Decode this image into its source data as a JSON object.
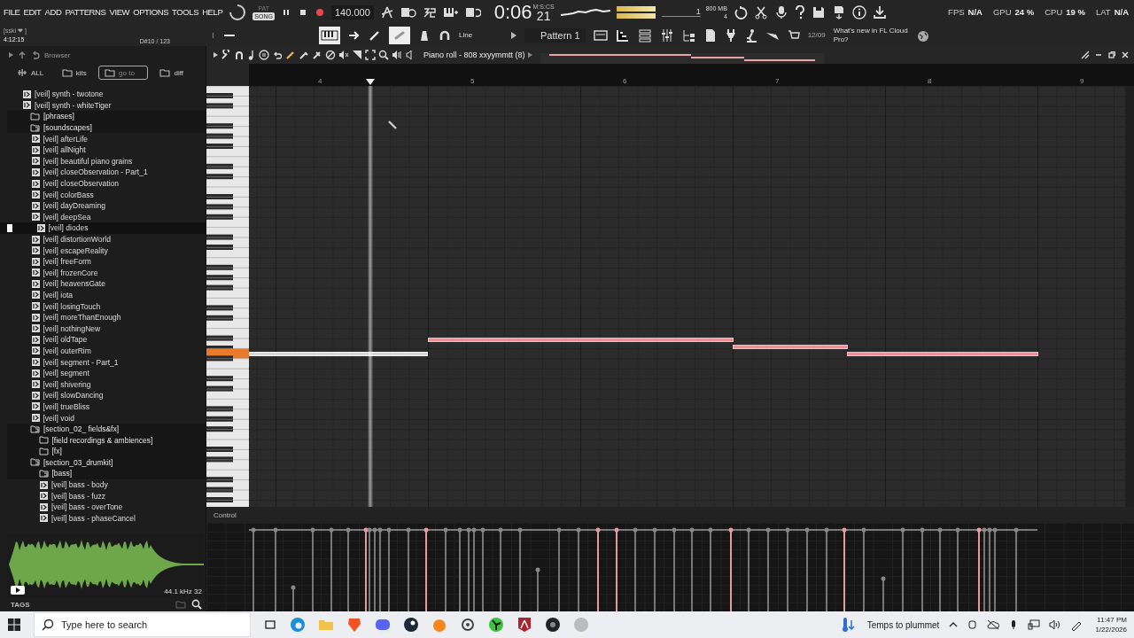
{
  "menu": [
    "FILE",
    "EDIT",
    "ADD",
    "PATTERNS",
    "VIEW",
    "OPTIONS",
    "TOOLS",
    "HELP"
  ],
  "transport": {
    "modes": [
      {
        "label": "PAT",
        "selected": false
      },
      {
        "label": "SONG",
        "selected": true
      }
    ],
    "tempo": "140.000",
    "time": "0:06",
    "time_cs": "21",
    "time_unit": "M:S:CS"
  },
  "meters": {
    "voices": "1",
    "memory": "800 MB",
    "cores": "4"
  },
  "stats": [
    {
      "label": "FPS",
      "value": "N/A"
    },
    {
      "label": "GPU",
      "value": "24 %"
    },
    {
      "label": "CPU",
      "value": "19 %"
    },
    {
      "label": "LAT",
      "value": "N/A"
    }
  ],
  "hint": {
    "user": "[sski ❤ ]",
    "position": "4:12:15",
    "note": "D#10 / 123"
  },
  "toolbar": {
    "zoom": {
      "level": 0.12
    },
    "snap": "Line",
    "pattern": "Pattern 1",
    "news_date": "12/09",
    "news_text": "What's new in FL Cloud Pro?"
  },
  "browser": {
    "title": "Browser",
    "filters": [
      {
        "label": "ALL",
        "selected": false
      },
      {
        "label": "kits",
        "selected": false
      },
      {
        "label": "go to",
        "selected": true
      },
      {
        "label": "diff",
        "selected": false
      }
    ],
    "tree": [
      {
        "children": [
          {
            "children": [
              {
                "label": "[veil] synth - twotone",
                "kind": "file",
                "selected": false
              },
              {
                "label": "[veil] synth - whiteTiger",
                "kind": "file",
                "selected": false
              }
            ]
          },
          {
            "label": "[phrases]",
            "kind": "folder",
            "expanded": false,
            "selected": false
          },
          {
            "label": "[soundscapes]",
            "kind": "folder",
            "expanded": true,
            "selected": false,
            "children": [
              {
                "label": "[veil] afterLife",
                "kind": "file",
                "selected": false
              },
              {
                "label": "[veil] allNight",
                "kind": "file",
                "selected": false
              },
              {
                "label": "[veil] beautiful piano grains",
                "kind": "file",
                "selected": false
              },
              {
                "label": "[veil] closeObservation - Part_1",
                "kind": "file",
                "selected": false
              },
              {
                "label": "[veil] closeObservation",
                "kind": "file",
                "selected": false
              },
              {
                "label": "[veil] colorBass",
                "kind": "file",
                "selected": false
              },
              {
                "label": "[veil] dayDreaming",
                "kind": "file",
                "selected": false
              },
              {
                "label": "[veil] deepSea",
                "kind": "file",
                "selected": false
              },
              {
                "label": "[veil] diodes",
                "kind": "file",
                "selected": true
              },
              {
                "label": "[veil] distortionWorld",
                "kind": "file",
                "selected": false
              },
              {
                "label": "[veil] escapeReality",
                "kind": "file",
                "selected": false
              },
              {
                "label": "[veil] freeForm",
                "kind": "file",
                "selected": false
              },
              {
                "label": "[veil] frozenCore",
                "kind": "file",
                "selected": false
              },
              {
                "label": "[veil] heavensGate",
                "kind": "file",
                "selected": false
              },
              {
                "label": "[veil] iota",
                "kind": "file",
                "selected": false
              },
              {
                "label": "[veil] losingTouch",
                "kind": "file",
                "selected": false
              },
              {
                "label": "[veil] moreThanEnough",
                "kind": "file",
                "selected": false
              },
              {
                "label": "[veil] nothingNew",
                "kind": "file",
                "selected": false
              },
              {
                "label": "[veil] oldTape",
                "kind": "file",
                "selected": false
              },
              {
                "label": "[veil] outerRim",
                "kind": "file",
                "selected": false
              },
              {
                "label": "[veil] segment - Part_1",
                "kind": "file",
                "selected": false
              },
              {
                "label": "[veil] segment",
                "kind": "file",
                "selected": false
              },
              {
                "label": "[veil] shivering",
                "kind": "file",
                "selected": false
              },
              {
                "label": "[veil] slowDancing",
                "kind": "file",
                "selected": false
              },
              {
                "label": "[veil] trueBliss",
                "kind": "file",
                "selected": false
              },
              {
                "label": "[veil] void",
                "kind": "file",
                "selected": false
              }
            ]
          }
        ]
      },
      {
        "label": "[section_02_ fields&fx]",
        "kind": "folder",
        "expanded": true,
        "selected": false,
        "children": [
          {
            "label": "[field recordings & ambiences]",
            "kind": "folder",
            "expanded": false,
            "selected": false
          },
          {
            "label": "[fx]",
            "kind": "folder",
            "expanded": false,
            "selected": false
          }
        ]
      },
      {
        "label": "[section_03_drumkit]",
        "kind": "folder",
        "expanded": true,
        "selected": false,
        "children": [
          {
            "label": "[bass]",
            "kind": "folder",
            "expanded": true,
            "selected": false,
            "children": [
              {
                "label": "[veil] bass - body",
                "kind": "file",
                "selected": false
              },
              {
                "label": "[veil] bass - fuzz",
                "kind": "file",
                "selected": false
              },
              {
                "label": "[veil] bass - overTone",
                "kind": "file",
                "selected": false
              },
              {
                "label": "[veil] bass - phaseCancel",
                "kind": "file",
                "selected": false
              }
            ]
          }
        ]
      }
    ],
    "sample_info": "44.1 kHz 32",
    "tags": "TAGS"
  },
  "piano_roll": {
    "title": "Piano roll - 808 xxyymmtt (8)",
    "bars": [
      "4",
      "5",
      "6",
      "7",
      "8",
      "9"
    ],
    "control": "Control"
  },
  "taskbar": {
    "search_placeholder": "Type here to search",
    "weather": "Temps to plummet",
    "time": "11:47 PM",
    "date": "1/22/2026"
  }
}
